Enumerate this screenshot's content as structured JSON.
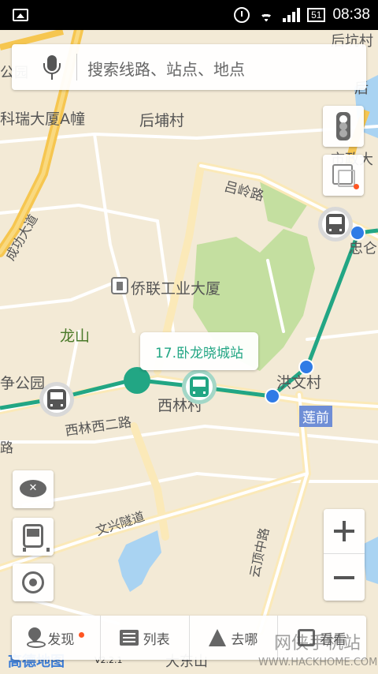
{
  "status_bar": {
    "time": "08:38",
    "battery": "51"
  },
  "search": {
    "placeholder": "搜索线路、站点、地点"
  },
  "map": {
    "labels": {
      "kexing_edge": "后坑村",
      "houjing_edge": "后",
      "left_edge_top": "公园",
      "kerui": "科瑞大厦A幢",
      "houbucun": "后埔村",
      "shizheng": "市政大",
      "luling": "吕岭路",
      "chenggong": "成功大道",
      "zhongren": "忠仑",
      "qiaolian": "侨联工业大厦",
      "longshan": "龙山",
      "zhengongyuan": "争公园",
      "hongwencun": "洪文村",
      "xilincun": "西林村",
      "xilinxierlu": "西林西二路",
      "lu_left": "路",
      "lianqian": "莲前",
      "wenxing": "文兴隧道",
      "yundingzhonglu": "云顶中路",
      "dadongshan": "大东山",
      "amap_logo": "高德地图",
      "version": "V2.2.1"
    },
    "station_callout": "17.卧龙晓城站"
  },
  "toolbar": {
    "discover": "发现",
    "list": "列表",
    "go": "去哪",
    "more": "看看"
  },
  "watermark": {
    "brand": "网侠手机站",
    "url": "WWW.HACKHOME.COM"
  },
  "colors": {
    "route": "#22a684",
    "stop_blue": "#2f7be6",
    "park": "#c4dfa0",
    "water": "#a9d3f2",
    "main_road": "#f6c650",
    "accent_red": "#ff5522"
  },
  "icons": [
    "mic-icon",
    "traffic-icon",
    "layer-icon",
    "zoom-in-icon",
    "zoom-out-icon",
    "eye-icon",
    "bus-icon",
    "location-icon",
    "pin-icon",
    "list-icon",
    "navigate-icon",
    "grid-icon"
  ]
}
